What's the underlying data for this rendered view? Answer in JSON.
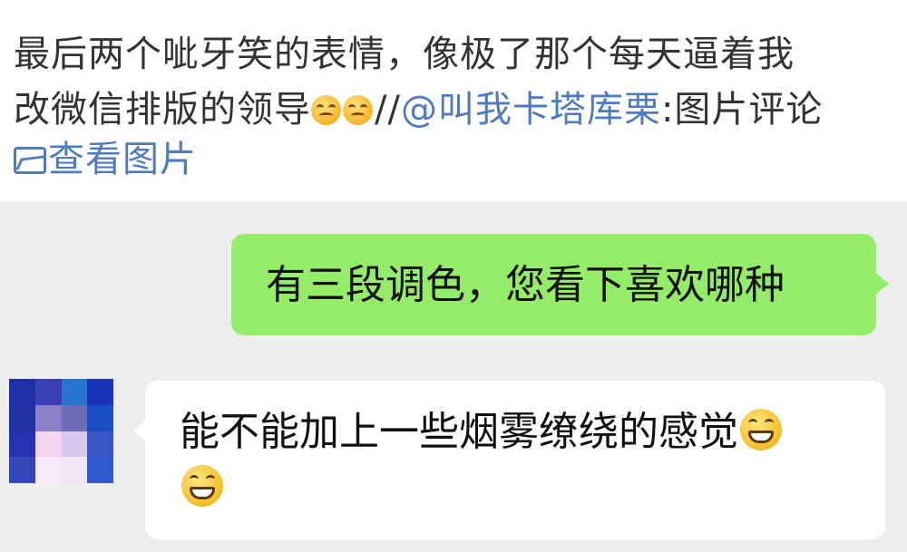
{
  "post": {
    "line1": "最后两个呲牙笑的表情，像极了那个每天逼着我",
    "line2_prefix": "改微信排版的领导",
    "line2_sep": "//",
    "line2_mention": "@叫我卡塔库栗",
    "line2_suffix": ":图片评论",
    "view_image_label": "查看图片",
    "icons": {
      "emoji": "upside-down-face",
      "image": "picture-icon"
    }
  },
  "chat": {
    "outgoing_message": "有三段调色，您看下喜欢哪种",
    "incoming_message": "能不能加上一些烟雾缭绕的感觉",
    "incoming_emoji": "grinning-face",
    "colors": {
      "background": "#ededed",
      "outgoing_bubble": "#95ec69",
      "incoming_bubble": "#ffffff",
      "link": "#4f7bbf"
    }
  },
  "avatar_pixels": [
    "#1f2fa8",
    "#3a3fb5",
    "#2a74d6",
    "#1b34b8",
    "#2230a6",
    "#8c7fc9",
    "#6e6bb8",
    "#1a4fc4",
    "#2633b0",
    "#f2d6f0",
    "#d7c6ee",
    "#3a57c8",
    "#3446b9",
    "#f7eaf6",
    "#f3e4f4",
    "#2f5bcf"
  ]
}
